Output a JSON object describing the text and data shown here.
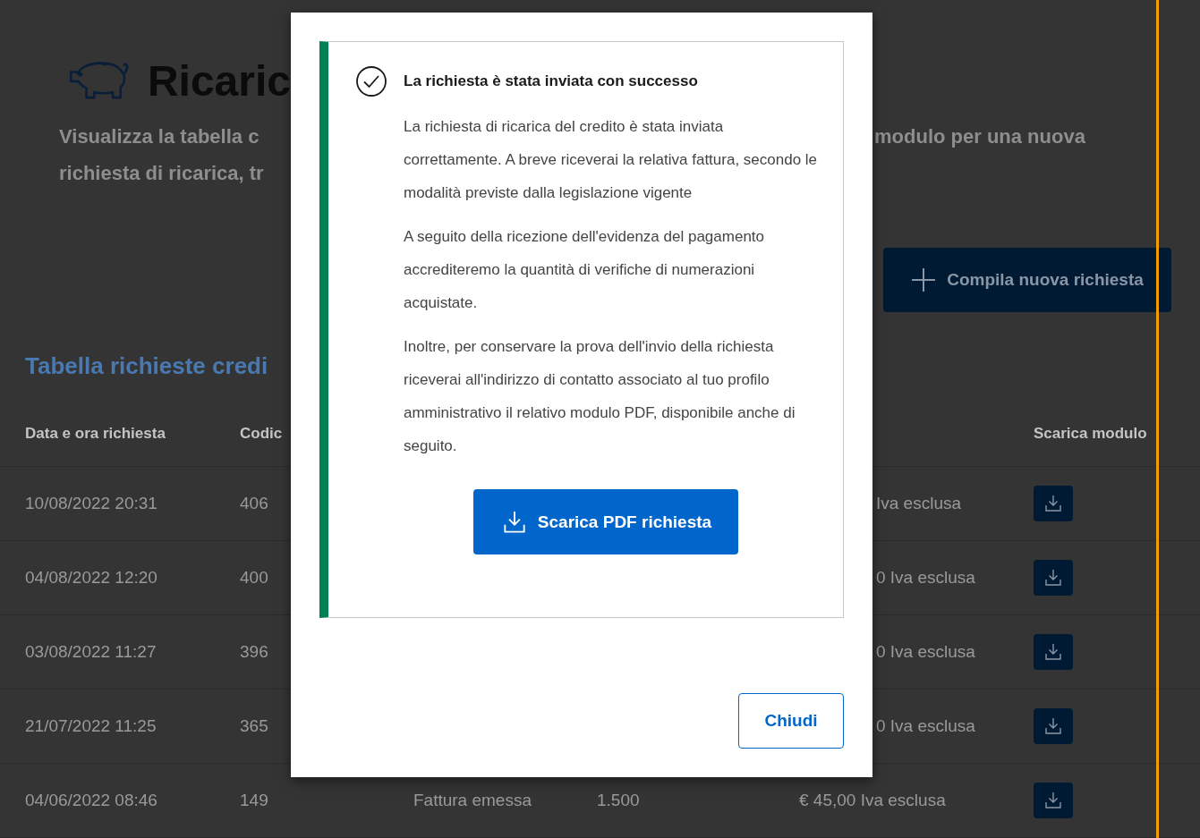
{
  "page": {
    "title": "Ricaric",
    "subtitle_left": [
      "Visualizza la tabella c",
      "richiesta di ricarica, tr"
    ],
    "subtitle_right": "modulo per una nuova",
    "new_request_button": "Compila nuova richiesta",
    "table_title": "Tabella richieste credi"
  },
  "table": {
    "columns": [
      "Data e ora richiesta",
      "Codic",
      null,
      null,
      null,
      "Scarica modulo"
    ],
    "rows": [
      {
        "cells": [
          "10/08/2022 20:31",
          "406",
          null,
          null,
          "Iva esclusa"
        ]
      },
      {
        "cells": [
          "04/08/2022 12:20",
          "400",
          null,
          null,
          "0 Iva esclusa"
        ]
      },
      {
        "cells": [
          "03/08/2022 11:27",
          "396",
          null,
          null,
          "0 Iva esclusa"
        ]
      },
      {
        "cells": [
          "21/07/2022 11:25",
          "365",
          null,
          null,
          "0 Iva esclusa"
        ]
      },
      {
        "cells": [
          "04/06/2022 08:46",
          "149",
          "Fattura emessa",
          "1.500",
          "€ 45,00 Iva esclusa"
        ]
      }
    ]
  },
  "dialog": {
    "title": "La richiesta è stata inviata con successo",
    "paragraphs": [
      "La richiesta di ricarica del credito è stata inviata correttamente. A breve riceverai la relativa fattura, secondo le modalità previste dalla legislazione vigente",
      "A seguito della ricezione dell'evidenza del pagamento accrediteremo la quantità di verifiche di numerazioni acquistate.",
      "Inoltre, per conservare la prova dell'invio della richiesta riceverai all'indirizzo di contatto associato al tuo profilo amministrativo il relativo modulo PDF, disponibile anche di seguito."
    ],
    "download_button": "Scarica PDF richiesta",
    "close_button": "Chiudi"
  }
}
